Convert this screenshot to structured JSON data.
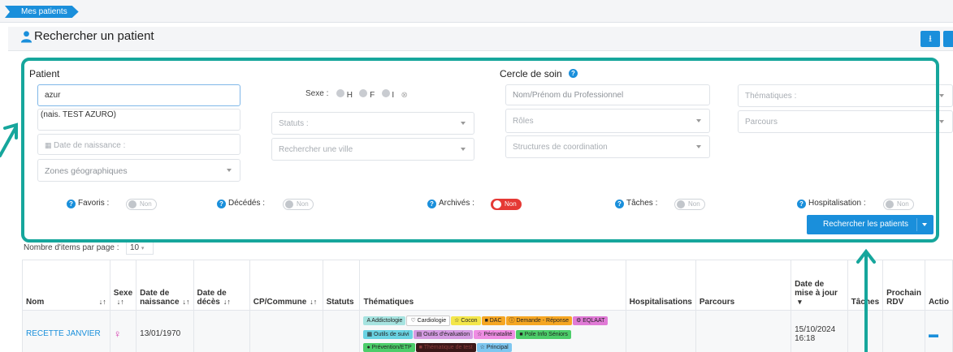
{
  "breadcrumb": {
    "label": "Mes patients"
  },
  "header": {
    "title": "Rechercher un patient"
  },
  "patient": {
    "section_title": "Patient",
    "search_value": "azur",
    "autocomplete_suggestion": "(nais. TEST AZURO)",
    "birthdate_placeholder": "Date de naissance :",
    "zones_placeholder": "Zones géographiques",
    "sexe_label": "Sexe :",
    "sexe_options": [
      "H",
      "F",
      "I"
    ],
    "statuts_placeholder": "Statuts :",
    "ville_placeholder": "Rechercher une ville"
  },
  "care_circle": {
    "section_title": "Cercle de soin",
    "pro_placeholder": "Nom/Prénom du Professionnel",
    "roles_placeholder": "Rôles",
    "structures_placeholder": "Structures de coordination",
    "thematiques_placeholder": "Thématiques :",
    "parcours_placeholder": "Parcours"
  },
  "toggles": [
    {
      "label": "Favoris :",
      "value": "Non",
      "on": false
    },
    {
      "label": "Décédés :",
      "value": "Non",
      "on": false
    },
    {
      "label": "Archivés :",
      "value": "Non",
      "on": true
    },
    {
      "label": "Tâches :",
      "value": "Non",
      "on": false
    },
    {
      "label": "Hospitalisation :",
      "value": "Non",
      "on": false
    }
  ],
  "search_button": {
    "label": "Rechercher les patients"
  },
  "pagination": {
    "items_label": "Nombre d'items par page :",
    "items_value": "10"
  },
  "table": {
    "headers": {
      "nom": "Nom",
      "sexe": "Sexe",
      "naissance": "Date de naissance",
      "deces": "Date de décès",
      "cp": "CP/Commune",
      "statuts": "Statuts",
      "thematiques": "Thématiques",
      "hospitalisations": "Hospitalisations",
      "parcours": "Parcours",
      "maj": "Date de mise à jour",
      "taches": "Tâches",
      "rdv": "Prochain RDV",
      "actions": "Actio"
    },
    "rows": [
      {
        "nom": "RECETTE JANVIER",
        "sexe": "♀",
        "naissance": "13/01/1970",
        "maj_date": "15/10/2024",
        "maj_time": "16:18",
        "tags": [
          {
            "label": "A Addictologie",
            "color": "#a6e3e0"
          },
          {
            "label": "♡ Cardiologie",
            "color": "#ffffff"
          },
          {
            "label": "☆ Cocon",
            "color": "#f3e64a"
          },
          {
            "label": "■ DAC",
            "color": "#f5a623"
          },
          {
            "label": "ⓘ Demande - Réponse",
            "color": "#f5a623"
          },
          {
            "label": "⚙ EQLAAT",
            "color": "#e07ad6"
          },
          {
            "label": "▦ Outils de suivi",
            "color": "#6ad3e3"
          },
          {
            "label": "▤ Outils d'évaluation",
            "color": "#d59be3"
          },
          {
            "label": "☆ Périnatalité",
            "color": "#ef8de3"
          },
          {
            "label": "■ Pole Info Séniors",
            "color": "#4ccd6a"
          },
          {
            "label": "● Prévention/ETP",
            "color": "#4ccd6a"
          },
          {
            "label": "■ Thématique de test",
            "color": "#3a1818"
          },
          {
            "label": "☆ Principal",
            "color": "#7ec7f0"
          }
        ]
      }
    ]
  },
  "colors": {
    "accent": "#1a8fdb",
    "highlight": "#16a69c",
    "toggle_on": "#e53935"
  }
}
